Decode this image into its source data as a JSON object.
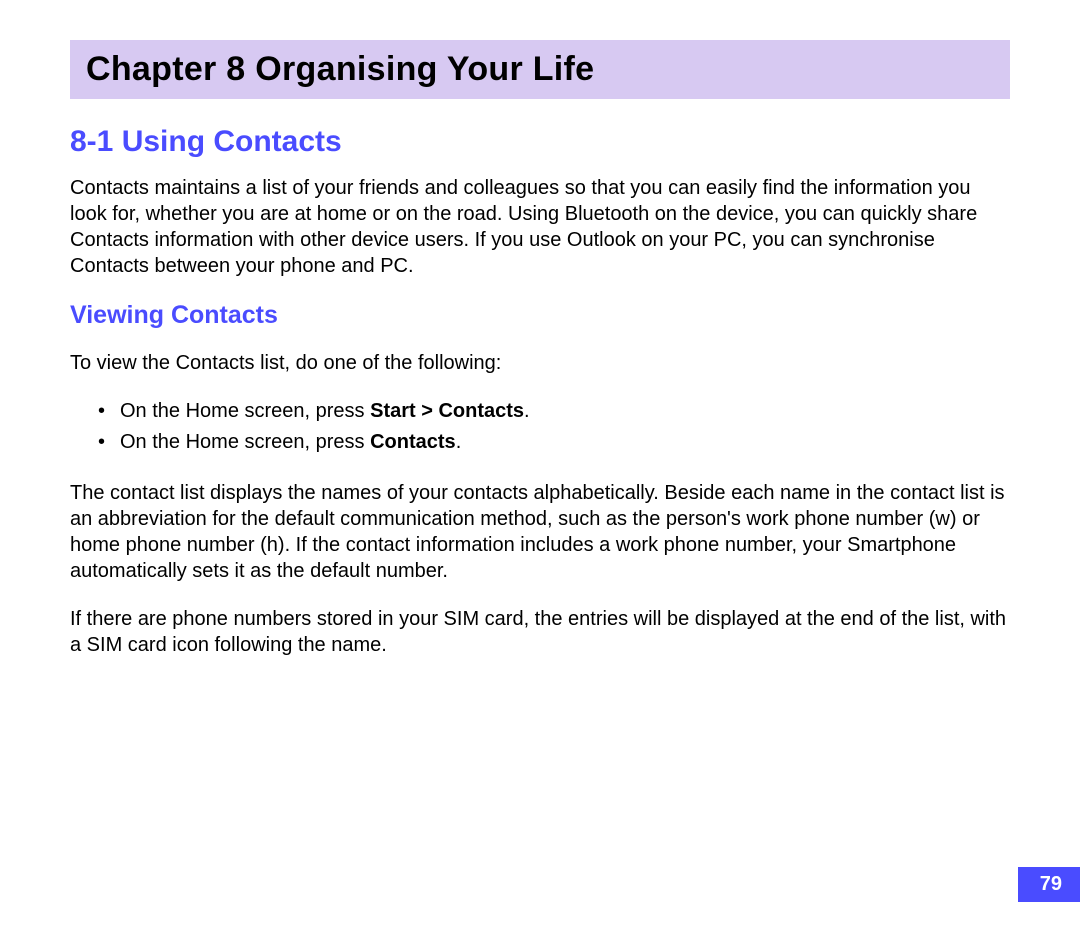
{
  "chapter": {
    "label": "Chapter  8    Organising Your Life"
  },
  "section": {
    "heading": "8-1   Using Contacts",
    "paragraph1": "Contacts maintains a list of your friends and colleagues so that you can easily find the information you look for, whether you are at home or on the road. Using Bluetooth on the device, you can quickly share Contacts information with other device users. If you use Outlook on your PC, you can synchronise Contacts between your phone and PC."
  },
  "subsection": {
    "heading": "Viewing Contacts",
    "intro": "To view the Contacts list, do one of the following:",
    "bullets": [
      {
        "prefix": "On the Home screen, press ",
        "bold": "Start > Contacts",
        "suffix": "."
      },
      {
        "prefix": "On the Home screen, press ",
        "bold": "Contacts",
        "suffix": "."
      }
    ],
    "paragraph_after_bullets": "The contact list displays the names of your contacts alphabetically. Beside each name in the contact list is an abbreviation for the default communication method, such as the person's work phone number (w) or home phone number (h). If the contact information includes a work phone number, your Smartphone automatically sets it as the default number.",
    "paragraph_final": "If there are phone numbers stored in your SIM card, the entries will be displayed at the end of the list, with a SIM card icon following the name."
  },
  "page_number": "79"
}
